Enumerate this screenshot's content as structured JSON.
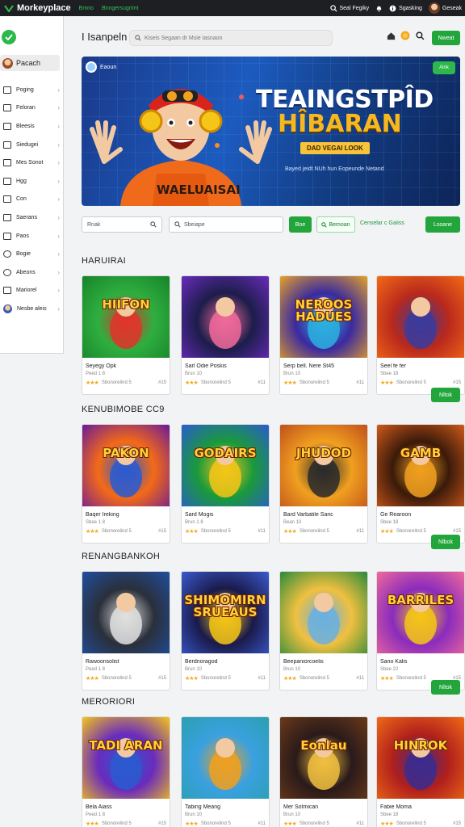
{
  "topbar": {
    "app_title": "Morkeyplace",
    "link1": "Bmno",
    "link2": "Bnngersugrimt",
    "right1": "Seal Fegiky",
    "right2": "Sgasking",
    "right3": "Geseak"
  },
  "sidebar": {
    "active_label": "Pacach",
    "items": [
      {
        "label": "Poging",
        "icon": "document-icon"
      },
      {
        "label": "Feloran",
        "icon": "check-box-icon"
      },
      {
        "label": "Bleesis",
        "icon": "grid-icon"
      },
      {
        "label": "Siedugei",
        "icon": "list-icon"
      },
      {
        "label": "Mes Sonot",
        "icon": "table-icon"
      },
      {
        "label": "Hgg",
        "icon": "edit-icon"
      },
      {
        "label": "Con",
        "icon": "window-icon"
      },
      {
        "label": "Saerans",
        "icon": "layers-icon"
      },
      {
        "label": "Paos",
        "icon": "page-icon"
      },
      {
        "label": "Bogie",
        "icon": "gear-icon"
      },
      {
        "label": "Abeons",
        "icon": "globe-icon"
      },
      {
        "label": "Mariorel",
        "icon": "book-icon"
      },
      {
        "label": "Nesbe aleis",
        "icon": "avatar"
      }
    ]
  },
  "header": {
    "title": "I Isanpeln",
    "search_placeholder": "Kiseis Segaan dr Msie Iasnaon",
    "button": "Nweat"
  },
  "hero": {
    "chip": "Eaoun",
    "corner_btn": "Alnk",
    "headline": "TEAINGSTPÎD",
    "subheadline": "HÎBARAN",
    "tag": "DAD VEGAI LOOK",
    "description": "Bayed jeidt NUh hun Eopeunde Netand"
  },
  "filters": {
    "search1": "Rnak",
    "search2": "Sbeiape",
    "btn1": "Boe",
    "btn2": "Bemoan",
    "link": "Censelar c Gaiiss",
    "btn3": "Lsoane"
  },
  "sections": [
    {
      "title": "HARUIRAI",
      "button": "",
      "cards": [
        {
          "title": "Seyegy Opk",
          "meta": "Peed 1 8",
          "rating_text": "Sbonorelind 5",
          "num": "#15",
          "thumb_text": "HIIFON"
        },
        {
          "title": "Sarl Odie Poskis",
          "meta": "Brun 10",
          "rating_text": "Sbonorelind 5",
          "num": "#11",
          "thumb_text": ""
        },
        {
          "title": "Serp bell. Nere St45",
          "meta": "Brun 10",
          "rating_text": "Sbonorelind 5",
          "num": "#11",
          "thumb_text": "NEROOS HADUES"
        },
        {
          "title": "Seel fe fer",
          "meta": "Sbee 18",
          "rating_text": "Sbonorelind 5",
          "num": "#15",
          "thumb_text": ""
        }
      ]
    },
    {
      "title": "KENUBIMOBE CC9",
      "button": "Nltok",
      "cards": [
        {
          "title": "Baqer Ireking",
          "meta": "Sbee 1 8",
          "rating_text": "Sbonorelind 5",
          "num": "#15",
          "thumb_text": "PAKON"
        },
        {
          "title": "Sard Mogis",
          "meta": "Brun 1 8",
          "rating_text": "Sbonorelind 5",
          "num": "#11",
          "thumb_text": "GODAIRS"
        },
        {
          "title": "Bard Varbatile Sanc",
          "meta": "Bean 10",
          "rating_text": "Sbonorelind 5",
          "num": "#11",
          "thumb_text": "JHUDOD"
        },
        {
          "title": "Ge Rearoon",
          "meta": "Sbee 18",
          "rating_text": "Sbonorelind 5",
          "num": "#15",
          "thumb_text": "GAMB"
        }
      ]
    },
    {
      "title": "RENANGBANKOH",
      "button": "Nlbok",
      "cards": [
        {
          "title": "Rawoonsolist",
          "meta": "Peed 1 8",
          "rating_text": "Sbonorelind 5",
          "num": "#15",
          "thumb_text": ""
        },
        {
          "title": "Berdnoragod",
          "meta": "Brun 10",
          "rating_text": "Sbonorelind 5",
          "num": "#11",
          "thumb_text": "SHIMOMIRN SRUEAUS"
        },
        {
          "title": "Beepaniorcoelis",
          "meta": "Brun 10",
          "rating_text": "Sbonorelind 5",
          "num": "#11",
          "thumb_text": ""
        },
        {
          "title": "Sano Kalis",
          "meta": "Sbee 22",
          "rating_text": "Sbonorelind 5",
          "num": "#15",
          "thumb_text": "BARRILES"
        }
      ]
    },
    {
      "title": "MERORIORI",
      "button": "Nltok",
      "cards": [
        {
          "title": "Bela Aiass",
          "meta": "Peed 1 8",
          "rating_text": "Sbonorelind 5",
          "num": "#15",
          "thumb_text": "TADI ARAN"
        },
        {
          "title": "Tabing Meang",
          "meta": "Brun 10",
          "rating_text": "Sbonorelind 5",
          "num": "#11",
          "thumb_text": ""
        },
        {
          "title": "Mer Sotmican",
          "meta": "Brun 10",
          "rating_text": "Sbonorelind 5",
          "num": "#11",
          "thumb_text": "Eonlau"
        },
        {
          "title": "Fabie Moma",
          "meta": "Sbee 18",
          "rating_text": "Sbonorelind 5",
          "num": "#15",
          "thumb_text": "HINROK"
        }
      ]
    }
  ],
  "colors": {
    "accent": "#22a63b",
    "topbar": "#1e1f22",
    "hero_blue": "#1c5bbf",
    "hero_gold": "#f5b820"
  }
}
